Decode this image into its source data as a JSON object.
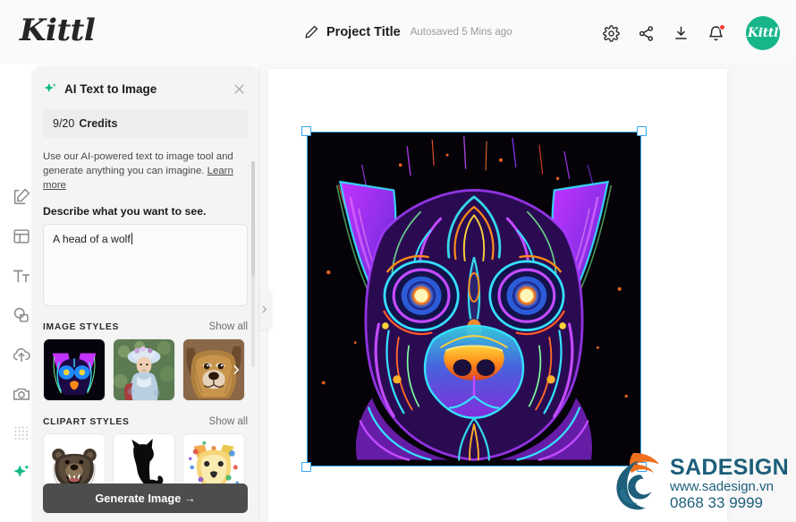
{
  "header": {
    "logo": "Kittl",
    "project_title": "Project Title",
    "autosave": "Autosaved 5 Mins ago",
    "icons": [
      "gear-icon",
      "share-icon",
      "download-icon",
      "bell-icon"
    ],
    "avatar_label": "Kittl",
    "avatar_color": "#16b58a"
  },
  "toolbar": {
    "items": [
      {
        "name": "edit-icon"
      },
      {
        "name": "templates-icon"
      },
      {
        "name": "text-icon"
      },
      {
        "name": "shapes-icon"
      },
      {
        "name": "upload-icon"
      },
      {
        "name": "photos-icon"
      },
      {
        "name": "grid-icon"
      },
      {
        "name": "ai-sparkle-icon",
        "active": true
      }
    ]
  },
  "panel": {
    "title": "AI Text to Image",
    "sparkle_color": "#12b886",
    "close_label": "close-icon",
    "credits_value": "9/20",
    "credits_label": "Credits",
    "blurb": "Use our AI-powered text to image tool and generate anything you can imagine.",
    "blurb_link": "Learn more",
    "describe_label": "Describe what you want to see.",
    "prompt_value": "A head of a wolf",
    "prompt_placeholder": "Describe what you want to see.",
    "sections": [
      {
        "title": "IMAGE STYLES",
        "show_all": "Show all",
        "thumbs": [
          "neon-dog-style",
          "impressionist-portrait-style",
          "realistic-dog-style"
        ]
      },
      {
        "title": "CLIPART STYLES",
        "show_all": "Show all",
        "thumbs": [
          "bear-clipart-style",
          "cat-silhouette-style",
          "watercolor-fox-style"
        ]
      }
    ],
    "generate_label": "Generate Image  →"
  },
  "canvas": {
    "selection": {
      "selected": true,
      "handle_color": "#35a5f0",
      "artwork": "neon-wolf-head"
    }
  },
  "watermark": {
    "name": "SADESIGN",
    "url": "www.sadesign.vn",
    "phone": "0868 33 9999",
    "color": "#1d5f7a",
    "flame_color": "#f07020"
  }
}
